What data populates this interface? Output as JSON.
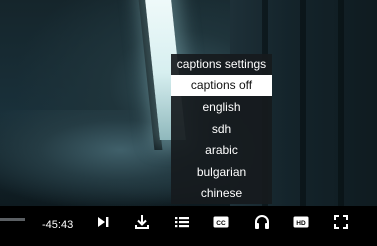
{
  "player": {
    "time_remaining": "-45:43"
  },
  "captions_menu": {
    "header": "captions settings",
    "options": [
      {
        "label": "captions off",
        "selected": true
      },
      {
        "label": "english",
        "selected": false
      },
      {
        "label": "sdh",
        "selected": false
      },
      {
        "label": "arabic",
        "selected": false
      },
      {
        "label": "bulgarian",
        "selected": false
      },
      {
        "label": "chinese",
        "selected": false
      }
    ]
  },
  "controls": {
    "icons": [
      "next-track-icon",
      "download-icon",
      "captions-list-icon",
      "cc-icon",
      "headphones-icon",
      "hd-icon",
      "fullscreen-icon"
    ],
    "icon_color": "#ffffff",
    "badge_text_cc": "CC",
    "badge_text_hd": "HD"
  }
}
